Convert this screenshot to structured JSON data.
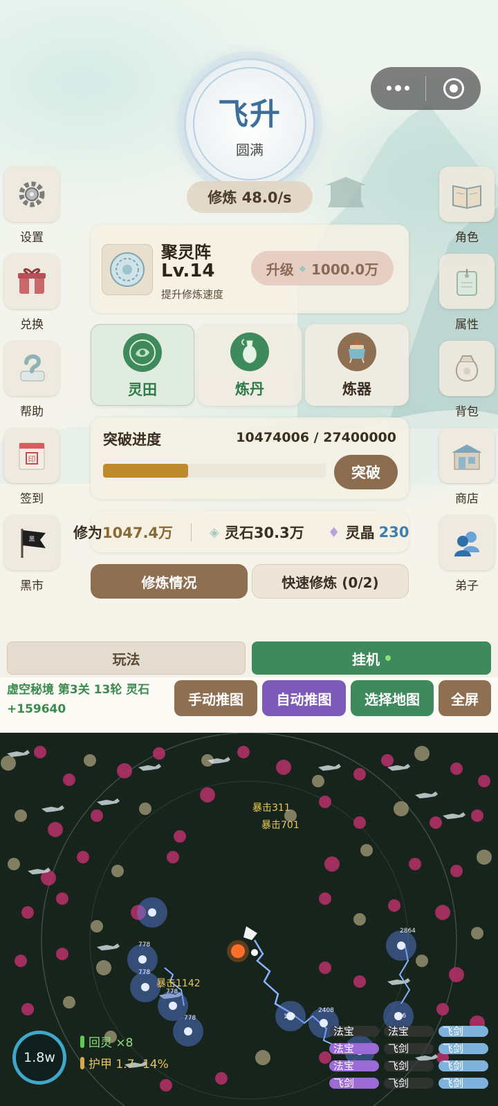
{
  "realm": {
    "title": "飞升",
    "subtitle": "圆满"
  },
  "cultivation_rate": "修炼 48.0/s",
  "side_left": [
    {
      "label": "设置",
      "icon": "gear-icon"
    },
    {
      "label": "兑换",
      "icon": "gift-box-icon"
    },
    {
      "label": "帮助",
      "icon": "question-scroll-icon"
    },
    {
      "label": "签到",
      "icon": "calendar-icon"
    },
    {
      "label": "黑市",
      "icon": "black-flag-icon"
    }
  ],
  "side_right": [
    {
      "label": "角色",
      "icon": "book-icon"
    },
    {
      "label": "属性",
      "icon": "tag-icon"
    },
    {
      "label": "背包",
      "icon": "pouch-icon"
    },
    {
      "label": "商店",
      "icon": "shop-icon"
    },
    {
      "label": "弟子",
      "icon": "disciples-icon"
    }
  ],
  "array": {
    "name": "聚灵阵",
    "level": "Lv.14",
    "desc": "提升修炼速度",
    "upgrade_label": "升级",
    "upgrade_cost": "1000.0万"
  },
  "functions": [
    {
      "label": "灵田",
      "icon": "spirit-field-icon",
      "active": true
    },
    {
      "label": "炼丹",
      "icon": "alchemy-vase-icon",
      "active": false
    },
    {
      "label": "炼器",
      "icon": "forge-cauldron-icon",
      "active": false
    }
  ],
  "breakthrough": {
    "title": "突破进度",
    "current": 10474006,
    "target": 27400000,
    "value_text": "10474006 / 27400000",
    "progress": 0.382,
    "button": "突破"
  },
  "resources": {
    "xiuwei_label": "修为",
    "xiuwei_value": "1047.4万",
    "lingshi_label": "灵石",
    "lingshi_value": "30.3万",
    "lingjing_label": "灵晶",
    "lingjing_value": "230"
  },
  "buttons": {
    "status": "修炼情况",
    "quick": "快速修炼 (0/2)"
  },
  "tabs": {
    "play": "玩法",
    "idle": "挂机"
  },
  "stage_text": "虚空秘境 第3关   13轮   灵石+159640",
  "actions": {
    "manual": "手动推图",
    "auto": "自动推图",
    "map": "选择地图",
    "full": "全屏"
  },
  "battle": {
    "speed": "1.8w",
    "buff_regen": "回灵 ×8",
    "buff_armor": "护甲 1.7 -14%",
    "crit_texts": [
      "暴击311",
      "暴击701",
      "暴击1142"
    ],
    "enemy_hp_labels": [
      "778",
      "778",
      "778",
      "778",
      "2408",
      "130",
      "366",
      "2864"
    ],
    "skills": [
      {
        "label": "法宝",
        "style": "dark"
      },
      {
        "label": "法宝",
        "style": "dark"
      },
      {
        "label": "飞剑",
        "style": "blue"
      },
      {
        "label": "法宝",
        "style": "purple"
      },
      {
        "label": "飞剑",
        "style": "dark"
      },
      {
        "label": "飞剑",
        "style": "blue"
      },
      {
        "label": "法宝",
        "style": "purple"
      },
      {
        "label": "飞剑",
        "style": "dark"
      },
      {
        "label": "飞剑",
        "style": "blue"
      },
      {
        "label": "飞剑",
        "style": "purple"
      },
      {
        "label": "飞剑",
        "style": "dark"
      },
      {
        "label": "飞剑",
        "style": "blue"
      }
    ]
  },
  "colors": {
    "accent_green": "#3f8a5c",
    "accent_brown": "#8e6f52",
    "accent_purple": "#7c5ab8",
    "progress_gold": "#bf8a2b",
    "crystal_blue": "#3f7fb0"
  }
}
